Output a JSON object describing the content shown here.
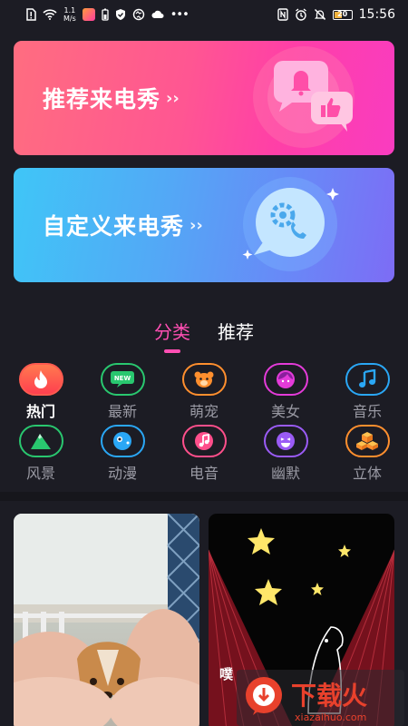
{
  "status_bar": {
    "speed_value": "1.1",
    "speed_unit": "M/s",
    "battery": "20",
    "time": "15:56",
    "left_icons": [
      "sim-alert-icon",
      "wifi-icon",
      "app-notification-icon",
      "battery-saver-icon",
      "shield-icon",
      "vpn-icon",
      "cloud-icon",
      "more-dots-icon"
    ],
    "right_icons": [
      "nfc-icon",
      "alarm-icon",
      "mute-icon",
      "battery-icon"
    ]
  },
  "banners": [
    {
      "title": "推荐来电秀",
      "arrow": "››",
      "icon": "chat-bell-like-icon"
    },
    {
      "title": "自定义来电秀",
      "arrow": "››",
      "icon": "phone-gear-icon"
    }
  ],
  "tabs": [
    {
      "label": "分类",
      "active": true
    },
    {
      "label": "推荐",
      "active": false
    }
  ],
  "categories": [
    {
      "label": "热门",
      "icon": "flame-icon",
      "color": "#ff5a4f",
      "active": true
    },
    {
      "label": "最新",
      "icon": "new-badge-icon",
      "color": "#29c76f",
      "badge": "NEW",
      "active": false
    },
    {
      "label": "萌宠",
      "icon": "pet-face-icon",
      "color": "#ff8f2e",
      "active": false
    },
    {
      "label": "美女",
      "icon": "girl-face-icon",
      "color": "#e43bd9",
      "active": false
    },
    {
      "label": "音乐",
      "icon": "music-note-icon",
      "color": "#2aa7f5",
      "active": false
    },
    {
      "label": "风景",
      "icon": "mountain-icon",
      "color": "#29c76f",
      "active": false
    },
    {
      "label": "动漫",
      "icon": "anime-icon",
      "color": "#2aa7f5",
      "active": false
    },
    {
      "label": "电音",
      "icon": "vinyl-icon",
      "color": "#ff4f8b",
      "active": false
    },
    {
      "label": "幽默",
      "icon": "smile-icon",
      "color": "#9a5bf5",
      "active": false
    },
    {
      "label": "立体",
      "icon": "cubes-icon",
      "color": "#ff8f2e",
      "active": false
    }
  ],
  "videos": [
    {
      "id_label": "video-card-puppy"
    },
    {
      "id_label": "video-card-stars",
      "caption": "噗"
    }
  ],
  "watermark": {
    "text": "下载火",
    "url": "xiazaihuo.com"
  }
}
